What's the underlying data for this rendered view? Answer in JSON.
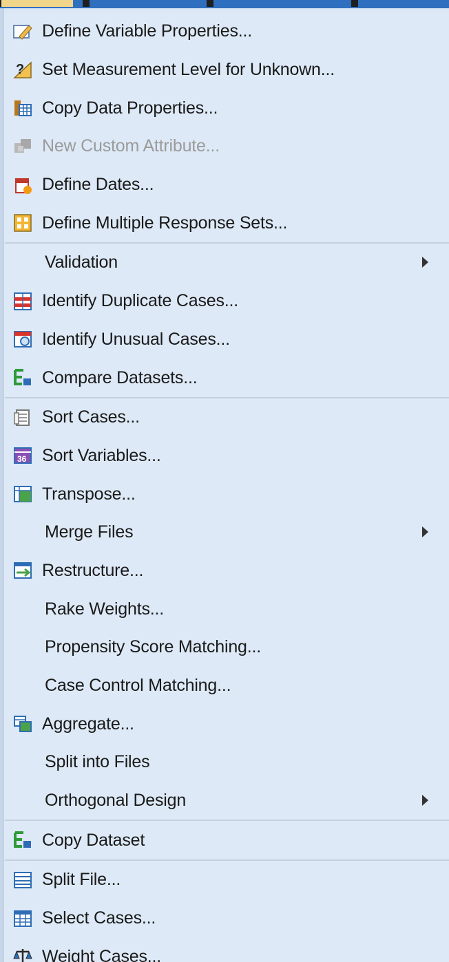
{
  "menu": {
    "items": [
      {
        "label": "Define Variable Properties...",
        "icon": "define-variable-properties-icon",
        "disabled": false,
        "submenu": false
      },
      {
        "label": "Set Measurement Level for Unknown...",
        "icon": "measurement-level-icon",
        "disabled": false,
        "submenu": false
      },
      {
        "label": "Copy Data Properties...",
        "icon": "copy-data-properties-icon",
        "disabled": false,
        "submenu": false
      },
      {
        "label": "New Custom Attribute...",
        "icon": "custom-attribute-icon",
        "disabled": true,
        "submenu": false
      },
      {
        "label": "Define Dates...",
        "icon": "define-dates-icon",
        "disabled": false,
        "submenu": false
      },
      {
        "label": "Define Multiple Response Sets...",
        "icon": "multiple-response-icon",
        "disabled": false,
        "submenu": false
      },
      {
        "label": "Validation",
        "icon": "",
        "disabled": false,
        "submenu": true
      },
      {
        "label": "Identify Duplicate Cases...",
        "icon": "duplicate-cases-icon",
        "disabled": false,
        "submenu": false
      },
      {
        "label": "Identify Unusual Cases...",
        "icon": "unusual-cases-icon",
        "disabled": false,
        "submenu": false
      },
      {
        "label": "Compare Datasets...",
        "icon": "compare-datasets-icon",
        "disabled": false,
        "submenu": false
      },
      {
        "label": "Sort Cases...",
        "icon": "sort-cases-icon",
        "disabled": false,
        "submenu": false
      },
      {
        "label": "Sort Variables...",
        "icon": "sort-variables-icon",
        "disabled": false,
        "submenu": false
      },
      {
        "label": "Transpose...",
        "icon": "transpose-icon",
        "disabled": false,
        "submenu": false
      },
      {
        "label": "Merge Files",
        "icon": "",
        "disabled": false,
        "submenu": true
      },
      {
        "label": "Restructure...",
        "icon": "restructure-icon",
        "disabled": false,
        "submenu": false
      },
      {
        "label": "Rake Weights...",
        "icon": "",
        "disabled": false,
        "submenu": false
      },
      {
        "label": "Propensity Score Matching...",
        "icon": "",
        "disabled": false,
        "submenu": false
      },
      {
        "label": "Case Control Matching...",
        "icon": "",
        "disabled": false,
        "submenu": false
      },
      {
        "label": "Aggregate...",
        "icon": "aggregate-icon",
        "disabled": false,
        "submenu": false
      },
      {
        "label": "Split into Files",
        "icon": "",
        "disabled": false,
        "submenu": false
      },
      {
        "label": "Orthogonal Design",
        "icon": "",
        "disabled": false,
        "submenu": true
      },
      {
        "label": "Copy Dataset",
        "icon": "copy-dataset-icon",
        "disabled": false,
        "submenu": false
      },
      {
        "label": "Split File...",
        "icon": "split-file-icon",
        "disabled": false,
        "submenu": false
      },
      {
        "label": "Select Cases...",
        "icon": "select-cases-icon",
        "disabled": false,
        "submenu": false
      },
      {
        "label": "Weight Cases...",
        "icon": "weight-cases-icon",
        "disabled": false,
        "submenu": false
      }
    ]
  }
}
